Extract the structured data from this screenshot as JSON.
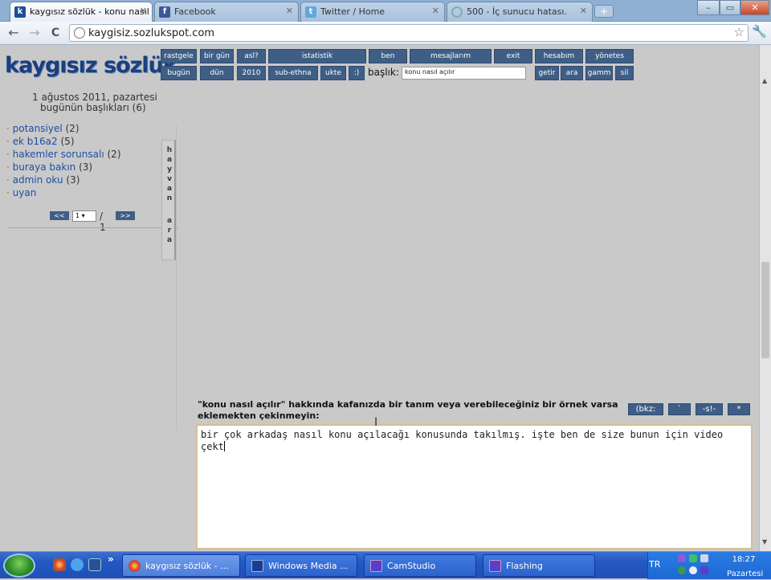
{
  "browser": {
    "tabs": [
      {
        "label": "kaygısız sözlük - konu nasıl",
        "icon": "site-icon",
        "active": true
      },
      {
        "label": "Facebook",
        "icon": "facebook-icon",
        "active": false
      },
      {
        "label": "Twitter / Home",
        "icon": "twitter-icon",
        "active": false
      },
      {
        "label": "500 - İç sunucu hatası.",
        "icon": "loading-icon",
        "active": false
      }
    ],
    "window_controls": [
      "–",
      "▭",
      "✕"
    ],
    "url": "kaygisiz.sozlukspot.com",
    "nav": {
      "back": "←",
      "forward": "→",
      "reload": "C",
      "star": "☆",
      "wrench": "🔧"
    }
  },
  "site": {
    "logo": "kaygısız sözlük",
    "menu_row1": [
      "rastgele",
      "bir gün",
      "asl?",
      "istatistik",
      "ben",
      "mesajlarım",
      "exit",
      "hesabım",
      "yönetes"
    ],
    "menu_row2": [
      "bugün",
      "dün",
      "2010",
      "sub-ethna",
      "ukte",
      ":)"
    ],
    "baslik_label": "başlık:",
    "baslik_value": "konu nasıl açılır",
    "menu_row2b": [
      "getir",
      "ara",
      "gamm",
      "sil"
    ],
    "date_line1": "1 ağustos 2011, pazartesi",
    "date_line2": "bugünün başlıkları (6)",
    "topics": [
      {
        "title": "potansiyel",
        "count": "(2)"
      },
      {
        "title": "ek b16a2",
        "count": "(5)"
      },
      {
        "title": "hakemler sorunsalı",
        "count": "(2)"
      },
      {
        "title": "buraya bakın",
        "count": "(3)"
      },
      {
        "title": "admin oku",
        "count": "(3)"
      },
      {
        "title": "uyan",
        "count": ""
      }
    ],
    "pager": {
      "prev": "<<",
      "next": ">>",
      "current": "1",
      "of": "/ 1"
    },
    "vertical_tab": [
      "h",
      "a",
      "y",
      "v",
      "a",
      "n",
      "",
      "a",
      "r",
      "a"
    ],
    "prompt": "\"konu nasıl açılır\" hakkında kafanızda bir tanım veya verebileceğiniz bir örnek varsa eklemekten çekinmeyin:",
    "format_buttons": [
      "(bkz:",
      "`",
      "-s!-",
      "*"
    ],
    "entry_text": "bir çok arkadaş nasıl konu açılacağı konusunda takılmış. işte ben de size bunun için video çekt"
  },
  "taskbar": {
    "tasks": [
      {
        "label": "kaygısız sözlük - ...",
        "active": true
      },
      {
        "label": "Windows Media ...",
        "active": false
      },
      {
        "label": "CamStudio",
        "active": false
      },
      {
        "label": "Flashing",
        "active": false
      }
    ],
    "expand": "»",
    "lang": "TR",
    "time": "18:27",
    "day": "Pazartesi"
  }
}
